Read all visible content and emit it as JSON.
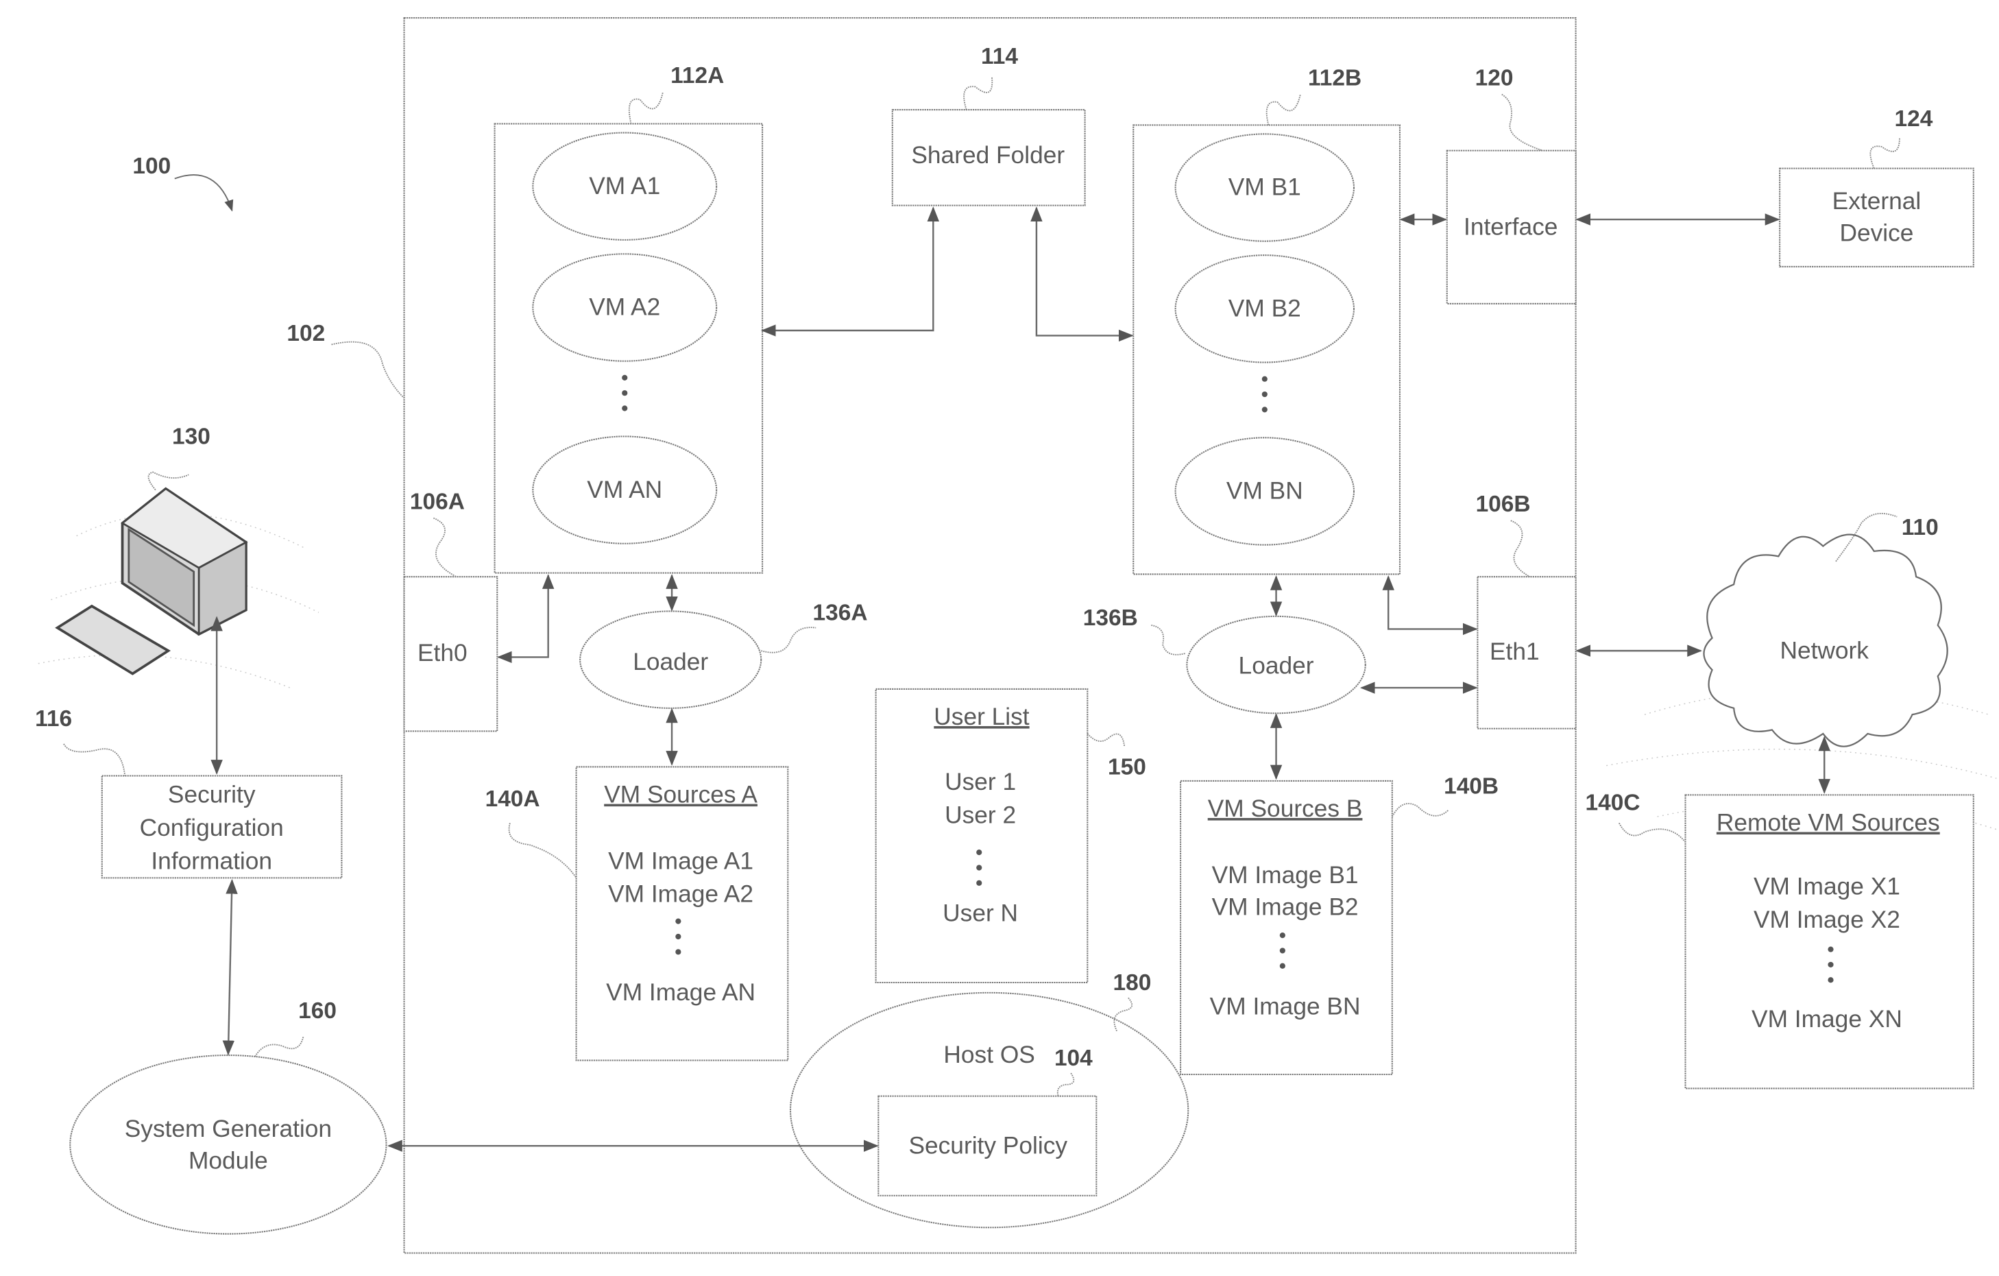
{
  "figure": {
    "system_ref": "100",
    "host_ref": "102"
  },
  "vm_group_a": {
    "ref": "112A",
    "vms": [
      "VM A1",
      "VM A2",
      "VM AN"
    ]
  },
  "vm_group_b": {
    "ref": "112B",
    "vms": [
      "VM B1",
      "VM B2",
      "VM BN"
    ]
  },
  "shared_folder": {
    "ref": "114",
    "label": "Shared Folder"
  },
  "interface": {
    "ref": "120",
    "label": "Interface"
  },
  "external_device": {
    "ref": "124",
    "label_line1": "External",
    "label_line2": "Device"
  },
  "eth0": {
    "ref": "106A",
    "label": "Eth0"
  },
  "eth1": {
    "ref": "106B",
    "label": "Eth1"
  },
  "loader_a": {
    "ref": "136A",
    "label": "Loader"
  },
  "loader_b": {
    "ref": "136B",
    "label": "Loader"
  },
  "network": {
    "ref": "110",
    "label": "Network"
  },
  "vm_sources_a": {
    "ref": "140A",
    "title": "VM Sources A",
    "items": [
      "VM Image A1",
      "VM Image A2",
      "VM Image AN"
    ]
  },
  "vm_sources_b": {
    "ref": "140B",
    "title": "VM Sources B",
    "items": [
      "VM Image B1",
      "VM Image B2",
      "VM Image BN"
    ]
  },
  "remote_vm_sources": {
    "ref": "140C",
    "title": "Remote VM Sources",
    "items": [
      "VM Image X1",
      "VM Image X2",
      "VM Image XN"
    ]
  },
  "user_list": {
    "ref": "150",
    "title": "User List",
    "items": [
      "User 1",
      "User 2",
      "User N"
    ]
  },
  "host_os": {
    "ref": "180",
    "label": "Host OS"
  },
  "security_policy": {
    "ref": "104",
    "label": "Security Policy"
  },
  "computer": {
    "ref": "130"
  },
  "security_config": {
    "ref": "116",
    "line1": "Security",
    "line2": "Configuration",
    "line3": "Information"
  },
  "system_generation": {
    "ref": "160",
    "line1": "System Generation",
    "line2": "Module"
  }
}
